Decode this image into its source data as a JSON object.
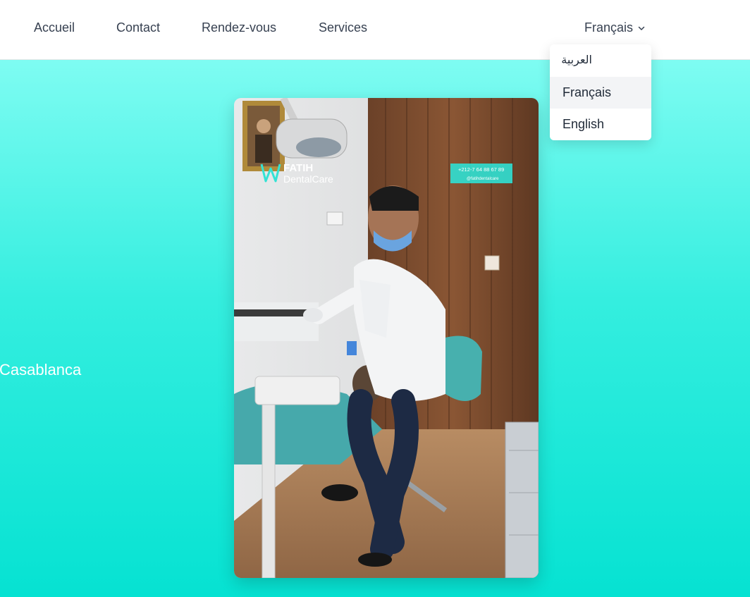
{
  "nav": {
    "links": [
      {
        "label": "Accueil"
      },
      {
        "label": "Contact"
      },
      {
        "label": "Rendez-vous"
      },
      {
        "label": "Services"
      }
    ],
    "language": {
      "current": "Français",
      "icon": "chevron-down-icon",
      "options": [
        {
          "label": "العربية"
        },
        {
          "label": "Français",
          "selected": true
        },
        {
          "label": "English"
        }
      ]
    }
  },
  "hero": {
    "city": "Casablanca",
    "gradient": [
      "#7efcf2",
      "#06e2d2"
    ],
    "video": {
      "brand_name": "FATIH",
      "brand_sub": "DentalCare",
      "phone": "+212-7 64 88 67 89",
      "handle": "@fatihdentalcare"
    }
  }
}
